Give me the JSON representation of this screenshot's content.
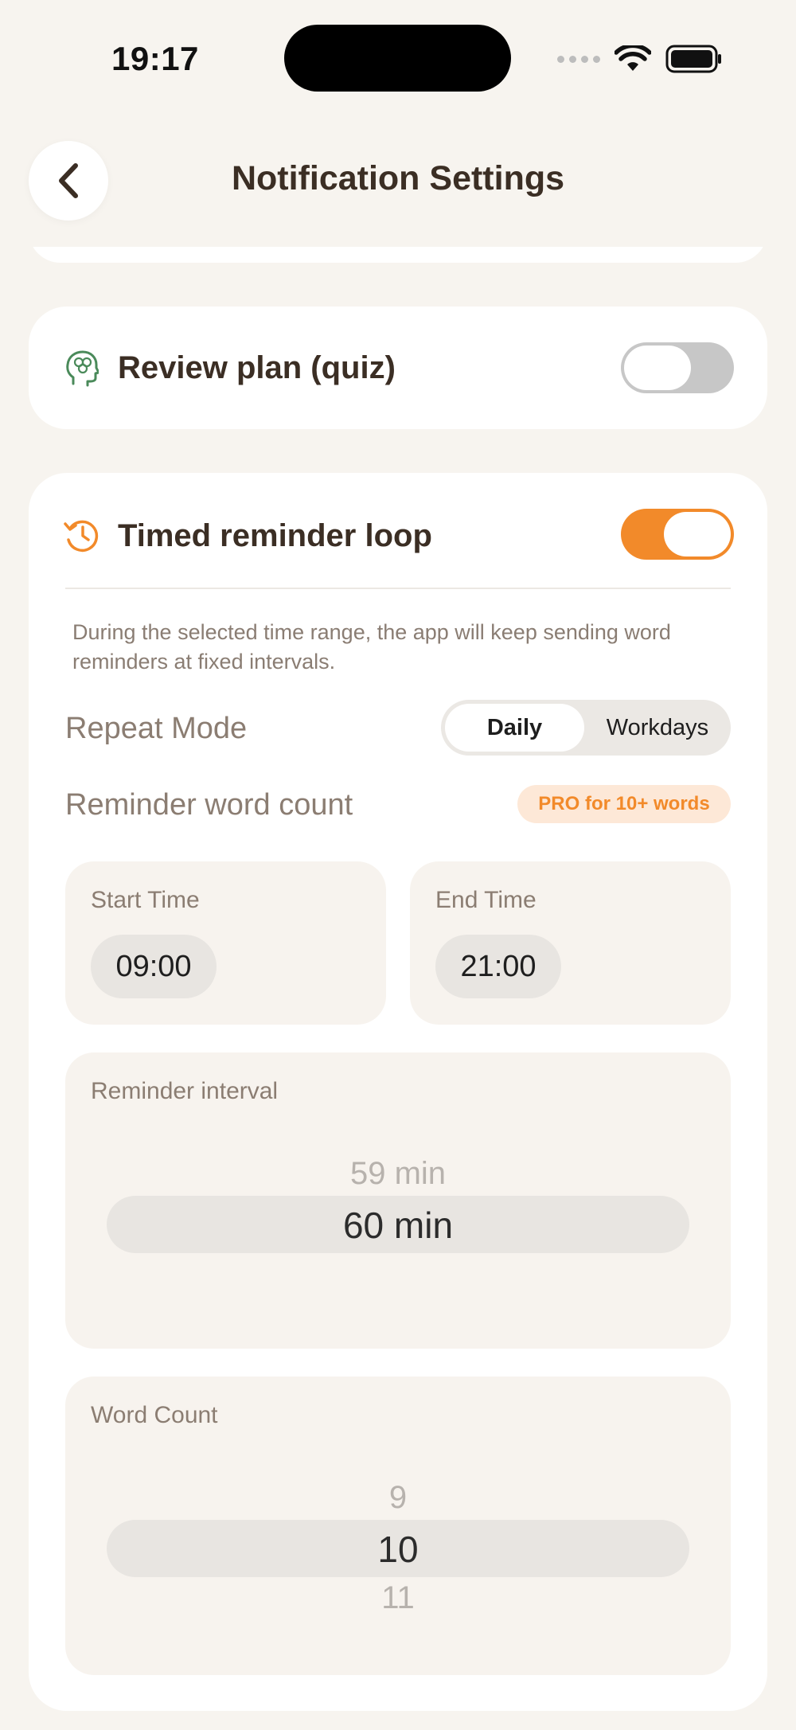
{
  "status_bar": {
    "time": "19:17"
  },
  "header": {
    "title": "Notification Settings"
  },
  "review_card": {
    "label": "Review plan (quiz)",
    "toggle_on": false
  },
  "reminder_card": {
    "label": "Timed reminder loop",
    "toggle_on": true,
    "description": "During the selected time range, the app will keep sending word reminders at fixed intervals.",
    "repeat_mode": {
      "label": "Repeat Mode",
      "options": [
        "Daily",
        "Workdays"
      ],
      "selected": "Daily"
    },
    "word_count_row": {
      "label": "Reminder word count",
      "badge": "PRO for 10+ words"
    },
    "start_time": {
      "label": "Start Time",
      "value": "09:00"
    },
    "end_time": {
      "label": "End Time",
      "value": "21:00"
    },
    "interval": {
      "label": "Reminder interval",
      "prev": "59 min",
      "current": "60 min"
    },
    "word_count": {
      "label": "Word Count",
      "prev": "9",
      "current": "10",
      "next": "11"
    }
  },
  "colors": {
    "accent": "#f28a2a",
    "background": "#f7f4ef",
    "brain_icon": "#4a8a5a"
  }
}
